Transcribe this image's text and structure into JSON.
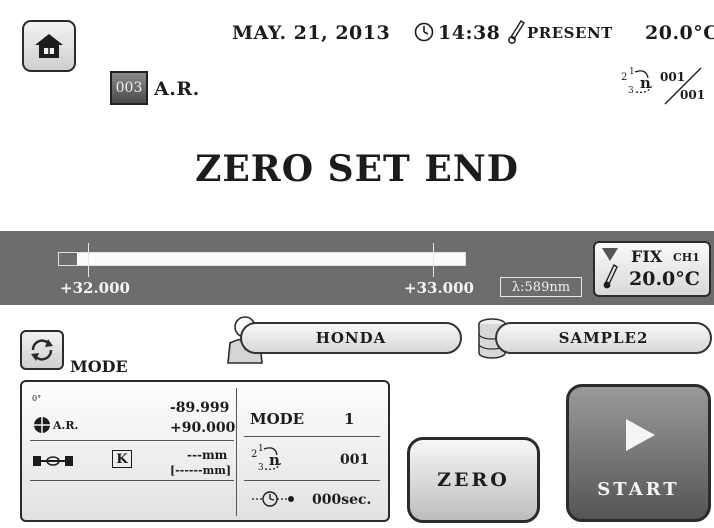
{
  "header": {
    "date": "MAY. 21, 2013",
    "time": "14:38",
    "temp_mode": "PRESENT",
    "temperature": "20.0°C"
  },
  "program": {
    "number": "003",
    "name": "A.R.",
    "count_current": "001",
    "count_total": "001"
  },
  "status_title": "ZERO SET END",
  "range_bar": {
    "left_label": "+32.000",
    "right_label": "+33.000",
    "wavelength": "λ:589nm",
    "fill_fraction": 0.05
  },
  "fix_box": {
    "label": "FIX",
    "channel": "CH1",
    "temperature": "20.0°C"
  },
  "mode_label": "MODE",
  "operator": "HONDA",
  "sample": "SAMPLE2",
  "settings": {
    "angle_mark": "0°",
    "ar_label": "A.R.",
    "min_value": "-89.999",
    "max_value": "+90.000",
    "k_label": "K",
    "length_value": "---mm",
    "length_range": "[------mm]",
    "mode_name": "MODE",
    "mode_value": "1",
    "repeat_value": "001",
    "delay_value": "000sec."
  },
  "buttons": {
    "zero": "ZERO",
    "start": "START"
  },
  "colors": {
    "band": "#6d6d6d",
    "start_button": "#707070"
  }
}
